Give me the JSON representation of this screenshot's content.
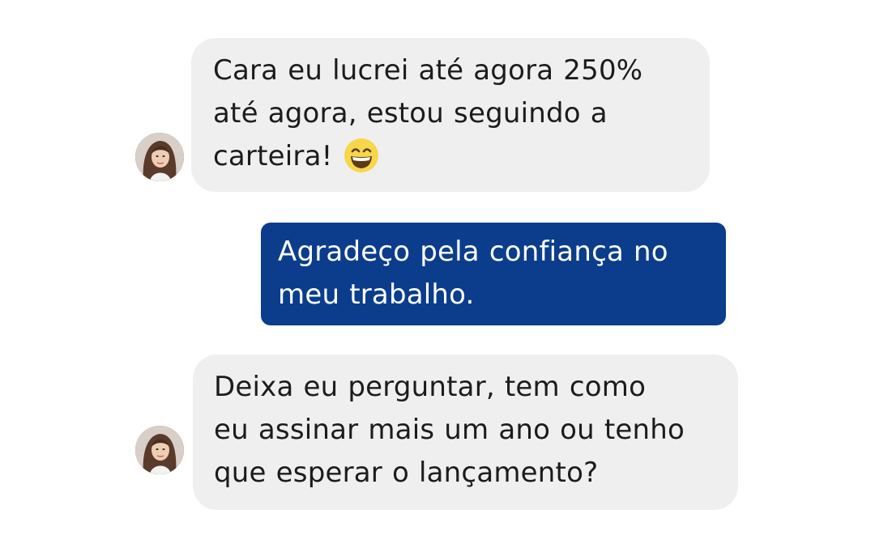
{
  "conversation": {
    "messages": [
      {
        "sender": "contact",
        "lines": [
          "Cara eu lucrei até agora 250%",
          "até agora, estou seguindo a",
          "carteira!"
        ],
        "emoji": "grinning-face-with-smiling-eyes-emoji"
      },
      {
        "sender": "me",
        "lines": [
          "Agradeço pela confiança no",
          "meu trabalho."
        ]
      },
      {
        "sender": "contact",
        "lines": [
          "Deixa eu perguntar, tem como",
          "eu assinar mais um ano ou tenho",
          "que esperar o lançamento?"
        ]
      }
    ]
  },
  "colors": {
    "received_bubble": "#efefef",
    "sent_bubble": "#0b3d8c",
    "received_text": "#1c1c1c",
    "sent_text": "#ffffff",
    "emoji_face": "#f7d749"
  }
}
